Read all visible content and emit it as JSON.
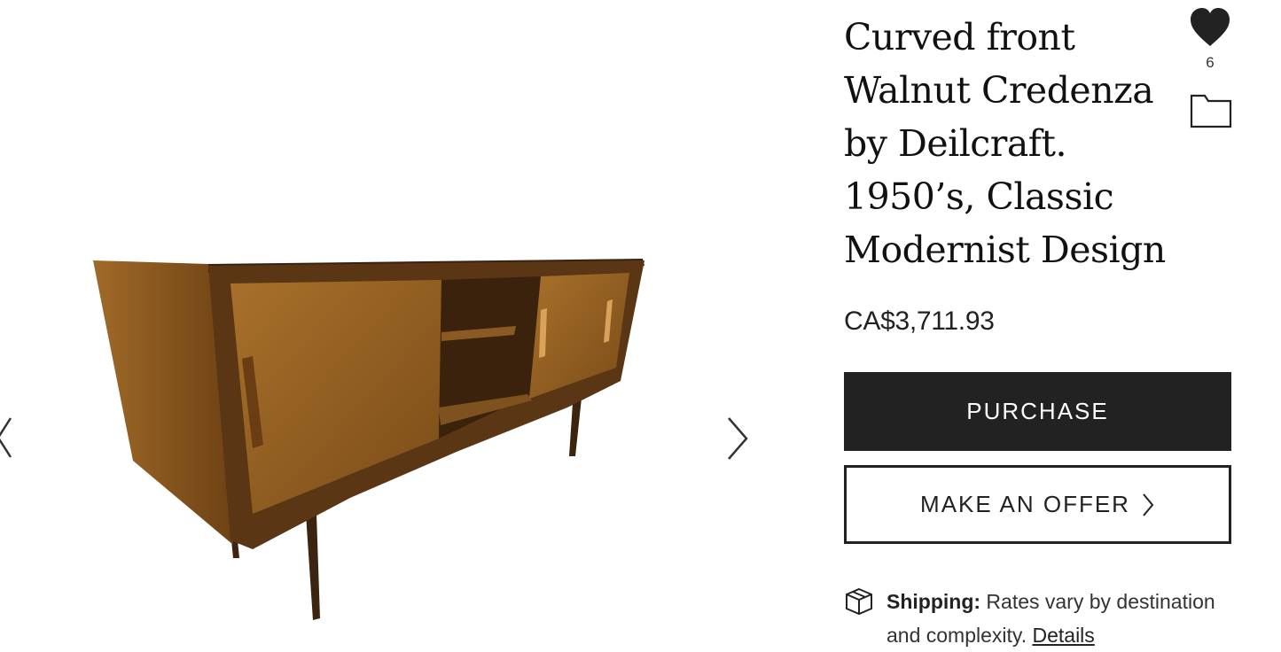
{
  "product": {
    "title": "Curved front Walnut Credenza by Deilcraft. 1950’s, Classic Modernist Design",
    "price": "CA$3,711.93",
    "favorite_count": "6"
  },
  "actions": {
    "purchase_label": "PURCHASE",
    "offer_label": "MAKE AN OFFER"
  },
  "shipping": {
    "label": "Shipping:",
    "text": "Rates vary by destination and complexity.",
    "link": "Details"
  },
  "icons": {
    "favorite": "heart-icon",
    "collection": "folder-icon",
    "shipping": "box-icon",
    "prev": "chevron-left-icon",
    "next": "chevron-right-icon",
    "offer": "chevron-right-icon"
  },
  "colors": {
    "primary_button": "#222222",
    "background": "#ffffff",
    "text": "#222222"
  }
}
